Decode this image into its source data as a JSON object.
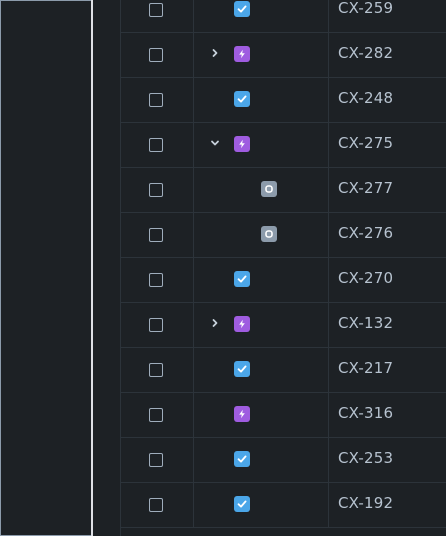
{
  "colors": {
    "task": "#4ba6e8",
    "epic": "#9f5ce0",
    "subtask": "#8c9bab"
  },
  "rows": [
    {
      "key": "CX-259",
      "type": "task-icon",
      "expander": "none",
      "level": 0
    },
    {
      "key": "CX-282",
      "type": "epic-icon",
      "expander": "chevron-right-icon",
      "level": 0
    },
    {
      "key": "CX-248",
      "type": "task-icon",
      "expander": "none",
      "level": 0
    },
    {
      "key": "CX-275",
      "type": "epic-icon",
      "expander": "chevron-down-icon",
      "level": 0
    },
    {
      "key": "CX-277",
      "type": "subtask-icon",
      "expander": "none",
      "level": 1
    },
    {
      "key": "CX-276",
      "type": "subtask-icon",
      "expander": "none",
      "level": 1
    },
    {
      "key": "CX-270",
      "type": "task-icon",
      "expander": "none",
      "level": 0
    },
    {
      "key": "CX-132",
      "type": "epic-icon",
      "expander": "chevron-right-icon",
      "level": 0
    },
    {
      "key": "CX-217",
      "type": "task-icon",
      "expander": "none",
      "level": 0
    },
    {
      "key": "CX-316",
      "type": "epic-icon",
      "expander": "none",
      "level": 0
    },
    {
      "key": "CX-253",
      "type": "task-icon",
      "expander": "none",
      "level": 0
    },
    {
      "key": "CX-192",
      "type": "task-icon",
      "expander": "none",
      "level": 0
    }
  ]
}
